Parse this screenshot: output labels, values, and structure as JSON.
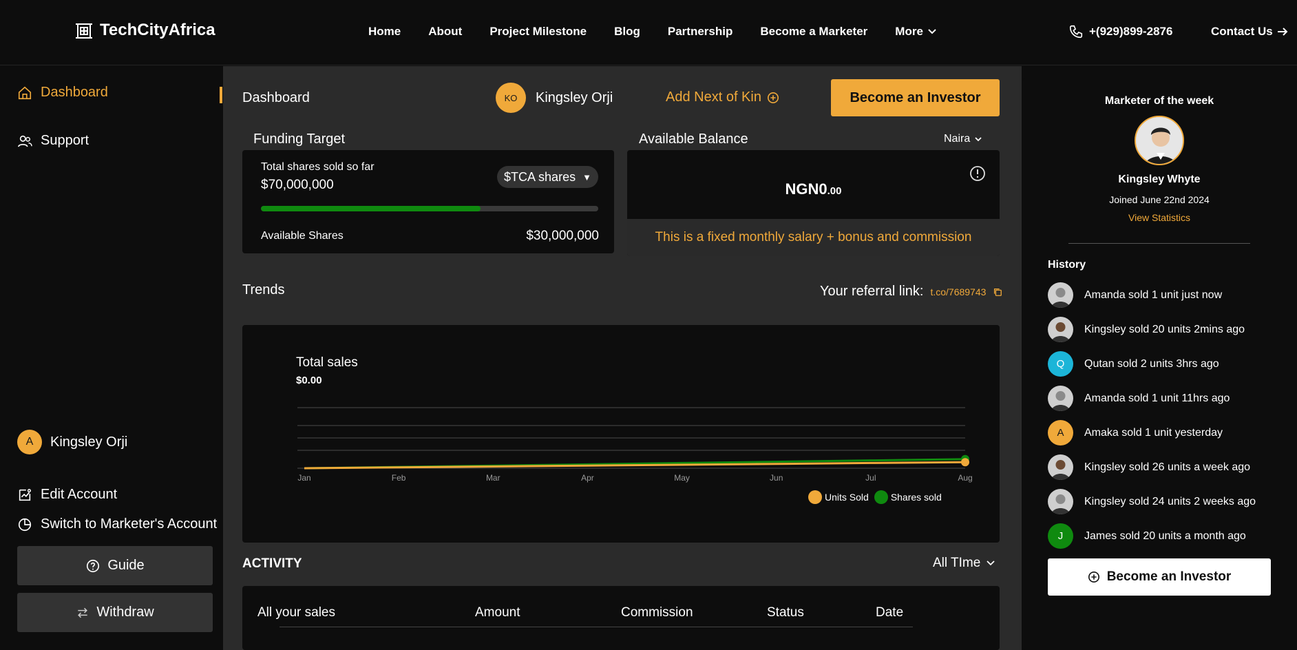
{
  "header": {
    "logo_text": "TechCityAfrica",
    "nav": [
      "Home",
      "About",
      "Project Milestone",
      "Blog",
      "Partnership",
      "Become a Marketer"
    ],
    "more_label": "More",
    "phone": "+(929)899-2876",
    "contact_label": "Contact Us"
  },
  "sidebar": {
    "dashboard_label": "Dashboard",
    "support_label": "Support",
    "user_initial": "A",
    "user_name": "Kingsley Orji",
    "edit_account_label": "Edit Account",
    "switch_label": "Switch to Marketer's Account",
    "guide_label": "Guide",
    "withdraw_label": "Withdraw"
  },
  "main": {
    "title": "Dashboard",
    "user_initials": "KO",
    "user_name": "Kingsley Orji",
    "add_kin_label": "Add Next of Kin",
    "invest_label": "Become an Investor",
    "funding": {
      "label": "Funding Target",
      "sold_label": "Total shares sold so far",
      "sold_value": "$70,000,000",
      "share_select": "$TCA shares",
      "progress_fraction": 0.65,
      "available_label": "Available Shares",
      "available_value": "$30,000,000"
    },
    "balance": {
      "label": "Available Balance",
      "currency_select": "Naira",
      "value_main": "NGN0",
      "value_decimal": ".00",
      "note": "This is a fixed monthly salary + bonus and commission"
    },
    "trends_label": "Trends",
    "referral": {
      "label": "Your referral link:",
      "link": "t.co/7689743"
    },
    "activity": {
      "title": "ACTIVITY",
      "filter": "All TIme",
      "columns": [
        "All your sales",
        "Amount",
        "Commission",
        "Status",
        "Date"
      ]
    }
  },
  "chart_data": {
    "type": "line",
    "title": "Total sales",
    "subtitle": "$0.00",
    "categories": [
      "Jan",
      "Feb",
      "Mar",
      "Apr",
      "May",
      "Jun",
      "Jul",
      "Aug"
    ],
    "series": [
      {
        "name": "Units Sold",
        "color": "#f0a93a",
        "values": [
          0,
          0.14,
          0.29,
          0.43,
          0.57,
          0.71,
          0.86,
          1
        ]
      },
      {
        "name": "Shares sold",
        "color": "#0f8a0f",
        "values": [
          0,
          0.21,
          0.43,
          0.64,
          0.86,
          1.07,
          1.29,
          1.5
        ]
      }
    ],
    "ylim": [
      0,
      10
    ],
    "grid": true,
    "legend": "bottom-right"
  },
  "right_panel": {
    "title": "Marketer of the week",
    "name": "Kingsley Whyte",
    "joined": "Joined June 22nd 2024",
    "stats_label": "View Statistics",
    "history_title": "History",
    "history": [
      {
        "text": "Amanda sold 1 unit just now",
        "type": "photo",
        "tone": "#8a8a8a"
      },
      {
        "text": "Kingsley sold 20 units 2mins ago",
        "type": "photo",
        "tone": "#6b4a33"
      },
      {
        "text": "Qutan sold 2 units 3hrs ago",
        "type": "initial",
        "initial": "Q",
        "color": "#1cb5d8"
      },
      {
        "text": "Amanda sold 1 unit 11hrs ago",
        "type": "photo",
        "tone": "#8a8a8a"
      },
      {
        "text": "Amaka sold 1 unit yesterday",
        "type": "initial",
        "initial": "A",
        "color": "#f0a93a"
      },
      {
        "text": "Kingsley sold 26 units a week ago",
        "type": "photo",
        "tone": "#6b4a33"
      },
      {
        "text": "Kingsley sold 24 units 2 weeks ago",
        "type": "photo",
        "tone": "#8a8a8a"
      },
      {
        "text": "James sold 20 units a month ago",
        "type": "initial",
        "initial": "J",
        "color": "#0f8a0f"
      }
    ],
    "invest_label": "Become an Investor"
  },
  "colors": {
    "accent": "#f0a93a",
    "green": "#0f8a0f"
  }
}
